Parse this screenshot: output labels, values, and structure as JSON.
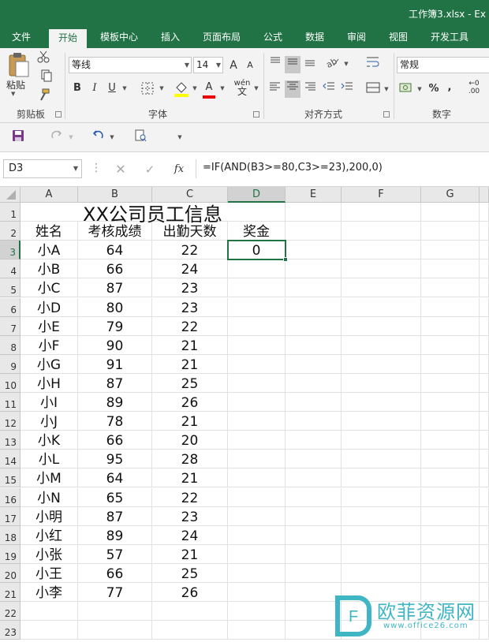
{
  "window": {
    "title": "工作簿3.xlsx - Ex"
  },
  "tabs": [
    {
      "label": "文件"
    },
    {
      "label": "开始"
    },
    {
      "label": "模板中心"
    },
    {
      "label": "插入"
    },
    {
      "label": "页面布局"
    },
    {
      "label": "公式"
    },
    {
      "label": "数据"
    },
    {
      "label": "审阅"
    },
    {
      "label": "视图"
    },
    {
      "label": "开发工具"
    }
  ],
  "active_tab": "开始",
  "ribbon": {
    "clipboard": {
      "label": "剪贴板",
      "paste_label": "粘贴"
    },
    "font": {
      "label": "字体",
      "font_name": "等线",
      "font_size": "14",
      "bold": "B",
      "italic": "I",
      "underline": "U",
      "grow": "A",
      "shrink": "A",
      "font_color_letter": "A",
      "wen": "wén"
    },
    "alignment": {
      "label": "对齐方式"
    },
    "number": {
      "label": "数字",
      "format": "常规",
      "percent": "%",
      "comma": ","
    }
  },
  "formula_bar": {
    "name_box": "D3",
    "fx": "fx",
    "formula": "=IF(AND(B3>=80,C3>=23),200,0)"
  },
  "columns": [
    "A",
    "B",
    "C",
    "D",
    "E",
    "F",
    "G"
  ],
  "row_numbers": [
    "1",
    "2",
    "3",
    "4",
    "5",
    "6",
    "7",
    "8",
    "9",
    "10",
    "11",
    "12",
    "13",
    "14",
    "15",
    "16",
    "17",
    "18",
    "19",
    "20",
    "21",
    "22",
    "23"
  ],
  "sheet": {
    "title": "XX公司员工信息",
    "headers": [
      "姓名",
      "考核成绩",
      "出勤天数",
      "奖金"
    ],
    "rows": [
      [
        "小A",
        "64",
        "22",
        "0"
      ],
      [
        "小B",
        "66",
        "24",
        ""
      ],
      [
        "小C",
        "87",
        "23",
        ""
      ],
      [
        "小D",
        "80",
        "23",
        ""
      ],
      [
        "小E",
        "79",
        "22",
        ""
      ],
      [
        "小F",
        "90",
        "21",
        ""
      ],
      [
        "小G",
        "91",
        "21",
        ""
      ],
      [
        "小H",
        "87",
        "25",
        ""
      ],
      [
        "小I",
        "89",
        "26",
        ""
      ],
      [
        "小J",
        "78",
        "21",
        ""
      ],
      [
        "小K",
        "66",
        "20",
        ""
      ],
      [
        "小L",
        "95",
        "28",
        ""
      ],
      [
        "小M",
        "64",
        "21",
        ""
      ],
      [
        "小N",
        "65",
        "22",
        ""
      ],
      [
        "小明",
        "87",
        "23",
        ""
      ],
      [
        "小红",
        "89",
        "24",
        ""
      ],
      [
        "小张",
        "57",
        "21",
        ""
      ],
      [
        "小王",
        "66",
        "25",
        ""
      ],
      [
        "小李",
        "77",
        "26",
        ""
      ]
    ]
  },
  "selected_cell": "D3",
  "watermark": {
    "brand": "欧菲资源网",
    "url": "www.office26.com",
    "logo_letter": "F"
  },
  "colors": {
    "accent": "#217346",
    "watermark": "#3fb6c4"
  }
}
